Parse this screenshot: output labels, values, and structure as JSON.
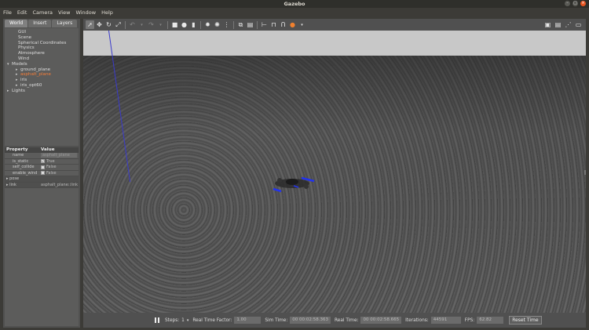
{
  "window": {
    "title": "Gazebo"
  },
  "menu": [
    "File",
    "Edit",
    "Camera",
    "View",
    "Window",
    "Help"
  ],
  "tabs": [
    "World",
    "Insert",
    "Layers"
  ],
  "tree": [
    {
      "label": "GUI",
      "level": 1,
      "arrow": ""
    },
    {
      "label": "Scene",
      "level": 1,
      "arrow": ""
    },
    {
      "label": "Spherical Coordinates",
      "level": 1,
      "arrow": ""
    },
    {
      "label": "Physics",
      "level": 1,
      "arrow": ""
    },
    {
      "label": "Atmosphere",
      "level": 1,
      "arrow": ""
    },
    {
      "label": "Wind",
      "level": 1,
      "arrow": ""
    },
    {
      "label": "Models",
      "level": 0,
      "arrow": "▾"
    },
    {
      "label": "ground_plane",
      "level": 2,
      "arrow": "▸"
    },
    {
      "label": "asphalt_plane",
      "level": 2,
      "arrow": "▸",
      "selected": true
    },
    {
      "label": "iris",
      "level": 2,
      "arrow": "▸"
    },
    {
      "label": "iris_opt60",
      "level": 2,
      "arrow": "▸"
    },
    {
      "label": "Lights",
      "level": 0,
      "arrow": "▸"
    }
  ],
  "properties": {
    "header": {
      "property": "Property",
      "value": "Value"
    },
    "rows": [
      {
        "key": "name",
        "value": "asphalt_plane",
        "kind": "box"
      },
      {
        "key": "is_static",
        "value": "True",
        "kind": "check",
        "checked": true
      },
      {
        "key": "self_collide",
        "value": "False",
        "kind": "check",
        "checked": false
      },
      {
        "key": "enable_wind",
        "value": "False",
        "kind": "check",
        "checked": false
      },
      {
        "key": "pose",
        "value": "",
        "kind": "group"
      },
      {
        "key": "link",
        "value": "asphalt_plane::link",
        "kind": "group"
      }
    ]
  },
  "bottombar": {
    "steps_label": "Steps:",
    "steps_value": "1",
    "rtf_label": "Real Time Factor:",
    "rtf_value": "1.00",
    "sim_time_label": "Sim Time:",
    "sim_time_value": "00 00:02:58.363",
    "real_time_label": "Real Time:",
    "real_time_value": "00 00:02:58.665",
    "iterations_label": "Iterations:",
    "iterations_value": "44591",
    "fps_label": "FPS:",
    "fps_value": "62.82",
    "reset_label": "Reset Time"
  },
  "colors": {
    "selected_tree": "#f57e3a",
    "sky": "#c8c8c8",
    "accent": "#e95420",
    "axis": "#3a3acc"
  }
}
